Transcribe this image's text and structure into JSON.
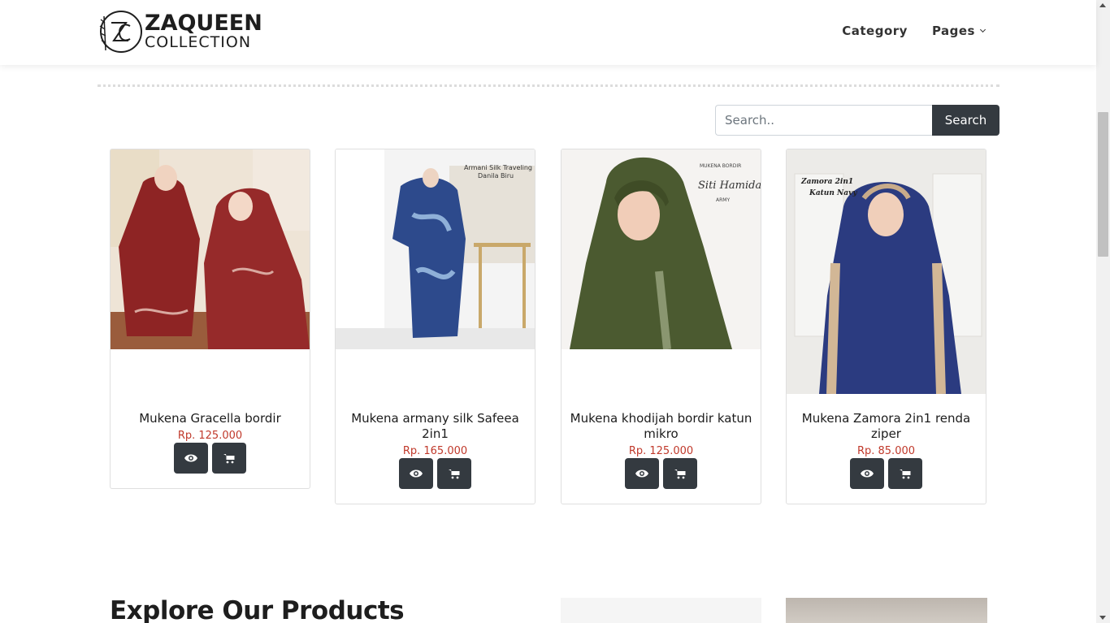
{
  "brand": {
    "title": "ZAQUEEN",
    "subtitle": "COLLECTION"
  },
  "nav": {
    "items": [
      {
        "label": "Category"
      },
      {
        "label": "Pages"
      }
    ]
  },
  "search": {
    "placeholder": "Search..",
    "button_label": "Search"
  },
  "products": [
    {
      "name": "Mukena Gracella bordir",
      "price": "Rp. 125.000",
      "image_color": "#8e2424"
    },
    {
      "name": "Mukena armany silk Safeea 2in1",
      "price": "Rp. 165.000",
      "image_overlay_text": [
        "Armani Silk Traveling",
        "Danila Biru"
      ],
      "image_color": "#2d4a8c"
    },
    {
      "name": "Mukena khodijah bordir katun mikro",
      "price": "Rp. 125.000",
      "image_overlay_text": [
        "MUKENA BORDIR",
        "Siti Hamidah",
        "ARMY"
      ],
      "image_color": "#4b5a30"
    },
    {
      "name": "Mukena Zamora 2in1 renda ziper",
      "price": "Rp. 85.000",
      "image_overlay_text": [
        "Zamora 2in1",
        "Katun Navy"
      ],
      "image_color": "#2b3b80"
    }
  ],
  "section": {
    "heading": "Explore Our Products"
  },
  "colors": {
    "accent_dark": "#343a40",
    "price": "#c0392b"
  },
  "icons": {
    "view": "eye-icon",
    "cart": "cart-icon"
  }
}
